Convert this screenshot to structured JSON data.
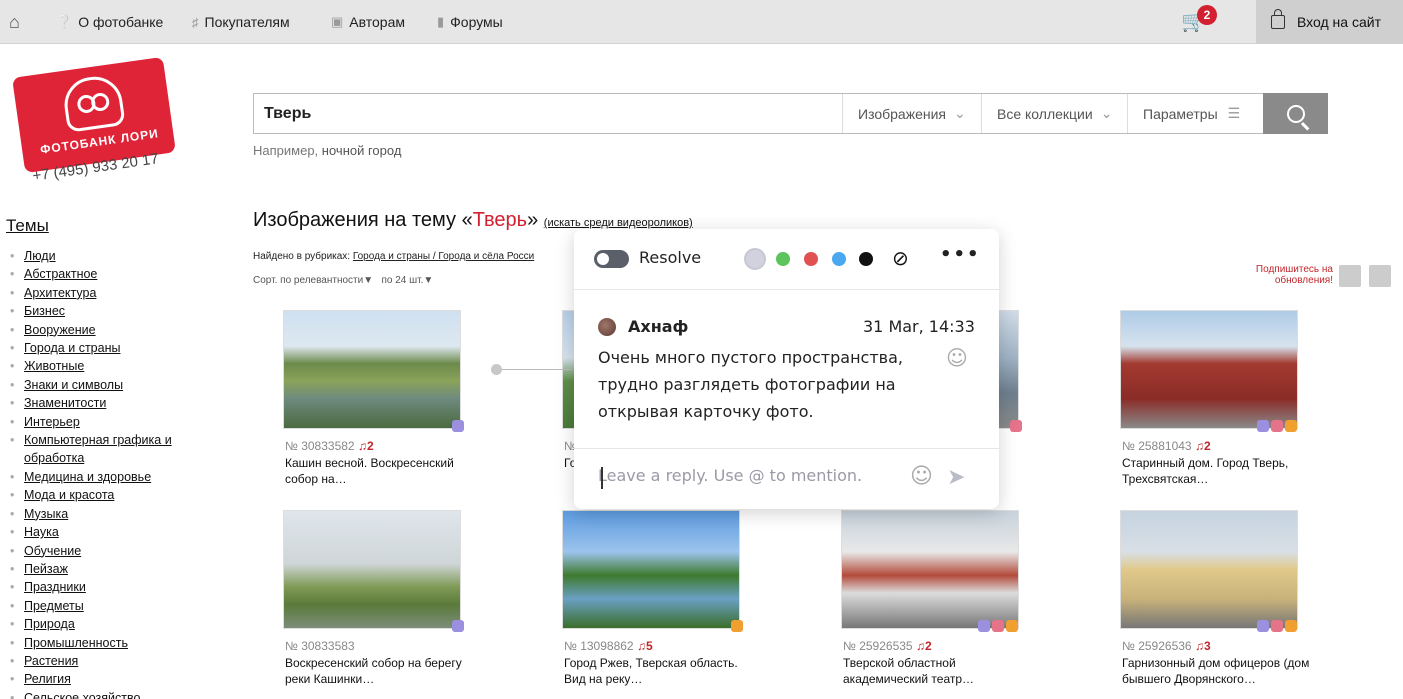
{
  "topnav": {
    "items": [
      {
        "label": "О фотобанке",
        "icon": "question-icon"
      },
      {
        "label": "Покупателям",
        "icon": "basket-icon"
      },
      {
        "label": "Авторам",
        "icon": "camera-icon"
      },
      {
        "label": "Форумы",
        "icon": "chat-icon"
      }
    ],
    "cart_count": "2",
    "login_label": "Вход на сайт"
  },
  "logo": {
    "text": "ФОТОБАНК ЛОРИ",
    "phone": "+7 (495) 933 20 17"
  },
  "search": {
    "query": "Тверь",
    "type_label": "Изображения",
    "collections_label": "Все коллекции",
    "params_label": "Параметры",
    "hint_prefix": "Например,",
    "hint_link": "ночной город"
  },
  "sidebar": {
    "title": "Темы",
    "items": [
      "Люди",
      "Абстрактное",
      "Архитектура",
      "Бизнес",
      "Вооружение",
      "Города и страны",
      "Животные",
      "Знаки и символы",
      "Знаменитости",
      "Интерьер",
      "Компьютерная графика и обработка",
      "Медицина и здоровье",
      "Мода и красота",
      "Музыка",
      "Наука",
      "Обучение",
      "Пейзаж",
      "Праздники",
      "Предметы",
      "Природа",
      "Промышленность",
      "Растения",
      "Религия",
      "Сельское хозяйство"
    ]
  },
  "results": {
    "heading_prefix": "Изображения на тему «",
    "heading_query": "Тверь",
    "heading_suffix": "»",
    "video_link": "(искать среди видеороликов)",
    "found_prefix": "Найдено в рубриках:",
    "found_link": "Города и страны / Города и сёла Росси",
    "sort_label": "Сорт. по релевантности▼",
    "per_page_label": "по 24 шт.▼",
    "subscribe_line1": "Подпишитесь на",
    "subscribe_line2": "обновления!",
    "cards": [
      {
        "id": "№ 30833582",
        "count": "2",
        "title": "Кашин весной. Воскресенский собор на…"
      },
      {
        "id": "№",
        "count": "",
        "title": "Го"
      },
      {
        "id": "",
        "count": "",
        "title": ""
      },
      {
        "id": "№ 25881043",
        "count": "2",
        "title": "Старинный дом. Город Тверь, Трехсвятская…"
      },
      {
        "id": "№ 30833583",
        "count": "",
        "title": "Воскресенский собор на берегу реки Кашинки…"
      },
      {
        "id": "№ 13098862",
        "count": "5",
        "title": "Город Ржев, Тверская область. Вид на реку…"
      },
      {
        "id": "№ 25926535",
        "count": "2",
        "title": "Тверской областной академический театр…"
      },
      {
        "id": "№ 25926536",
        "count": "3",
        "title": "Гарнизонный дом офицеров (дом бывшего Дворянского…"
      }
    ]
  },
  "comment_popup": {
    "resolve_label": "Resolve",
    "colors": [
      "#d2d2de",
      "#5cc45c",
      "#e05252",
      "#4aa8f0",
      "#111111"
    ],
    "author": "Ахнаф",
    "date": "31 Mar, 14:33",
    "text": "Очень много пустого пространства, трудно разглядеть фотографии на открывая карточку фото.",
    "reply_placeholder": "Leave a reply. Use @ to mention."
  }
}
